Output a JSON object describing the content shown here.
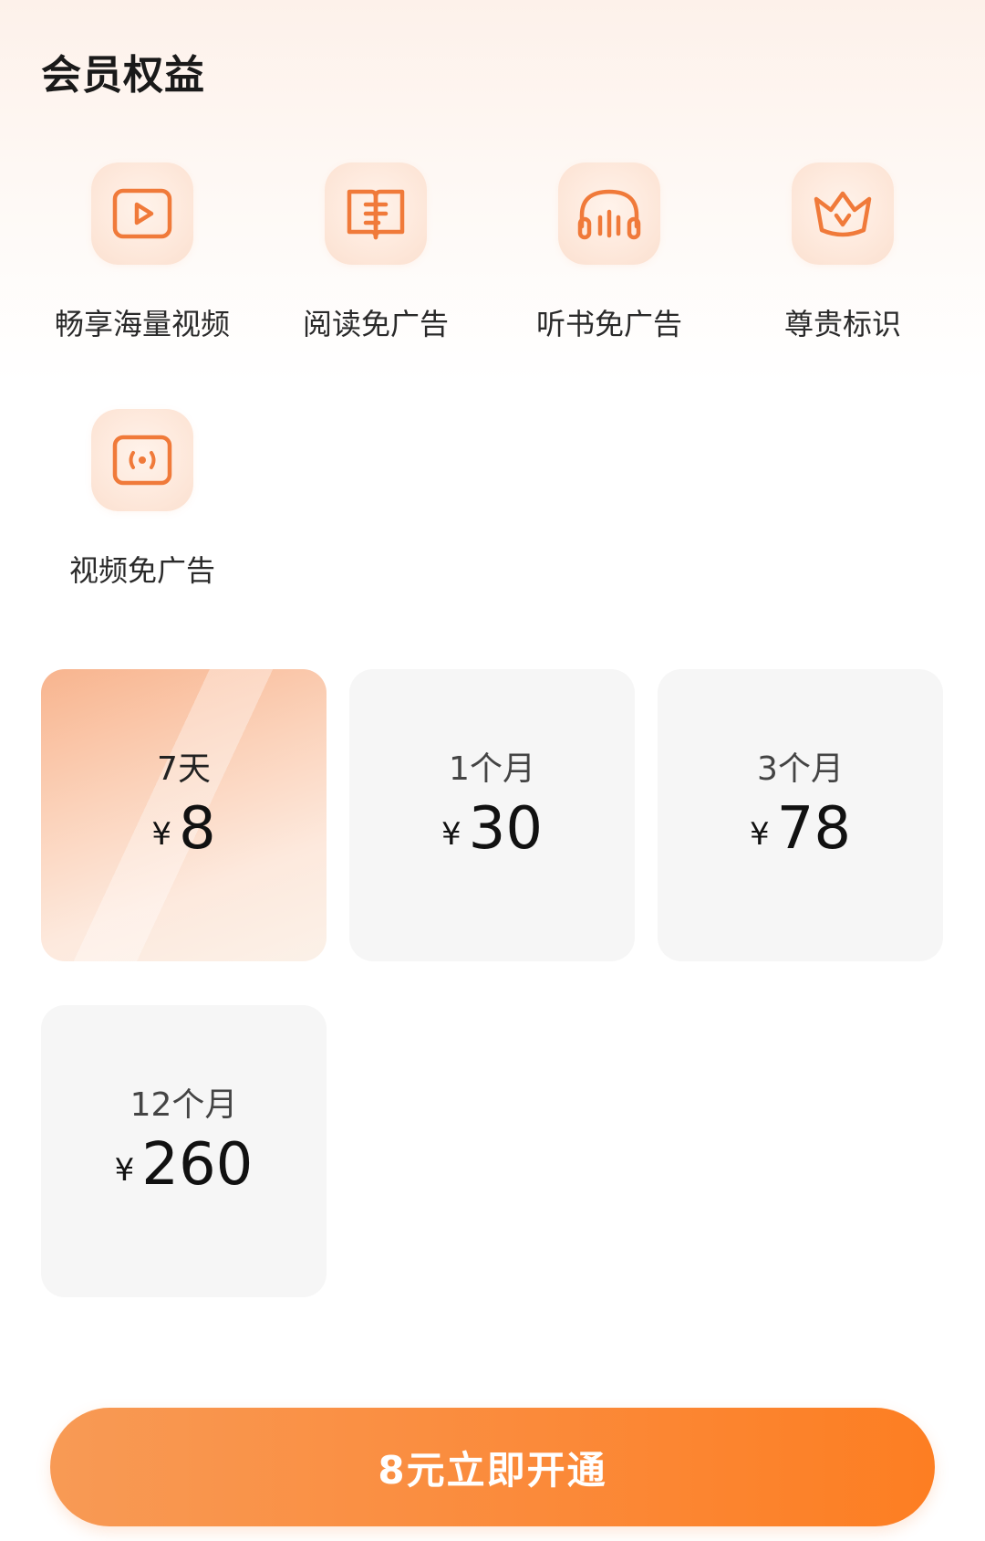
{
  "page": {
    "title": "会员权益"
  },
  "benefits": [
    {
      "label": "畅享海量视频",
      "icon": "video-play-icon"
    },
    {
      "label": "阅读免广告",
      "icon": "book-icon"
    },
    {
      "label": "听书免广告",
      "icon": "headphones-icon"
    },
    {
      "label": "尊贵标识",
      "icon": "crown-icon"
    },
    {
      "label": "视频免广告",
      "icon": "broadcast-icon"
    }
  ],
  "plans": [
    {
      "duration": "7天",
      "currency": "¥",
      "price": "8",
      "selected": true
    },
    {
      "duration": "1个月",
      "currency": "¥",
      "price": "30",
      "selected": false
    },
    {
      "duration": "3个月",
      "currency": "¥",
      "price": "78",
      "selected": false
    },
    {
      "duration": "12个月",
      "currency": "¥",
      "price": "260",
      "selected": false
    }
  ],
  "cta": {
    "label": "8元立即开通"
  },
  "colors": {
    "accent": "#fd7e22",
    "icon_stroke": "#f07a3a"
  }
}
